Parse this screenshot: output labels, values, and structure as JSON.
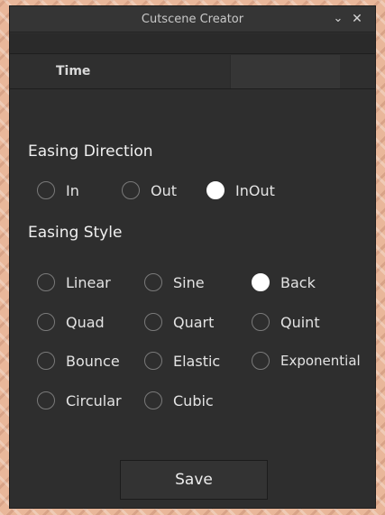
{
  "window": {
    "title": "Cutscene Creator",
    "collapse_icon": "chevron-down",
    "close_icon": "close"
  },
  "time": {
    "label": "Time",
    "value": ""
  },
  "easing_direction": {
    "label": "Easing Direction",
    "options": [
      "In",
      "Out",
      "InOut"
    ],
    "selected": "InOut"
  },
  "easing_style": {
    "label": "Easing Style",
    "options": [
      "Linear",
      "Sine",
      "Back",
      "Quad",
      "Quart",
      "Quint",
      "Bounce",
      "Elastic",
      "Exponential",
      "Circular",
      "Cubic"
    ],
    "selected": "Back"
  },
  "save_label": "Save"
}
